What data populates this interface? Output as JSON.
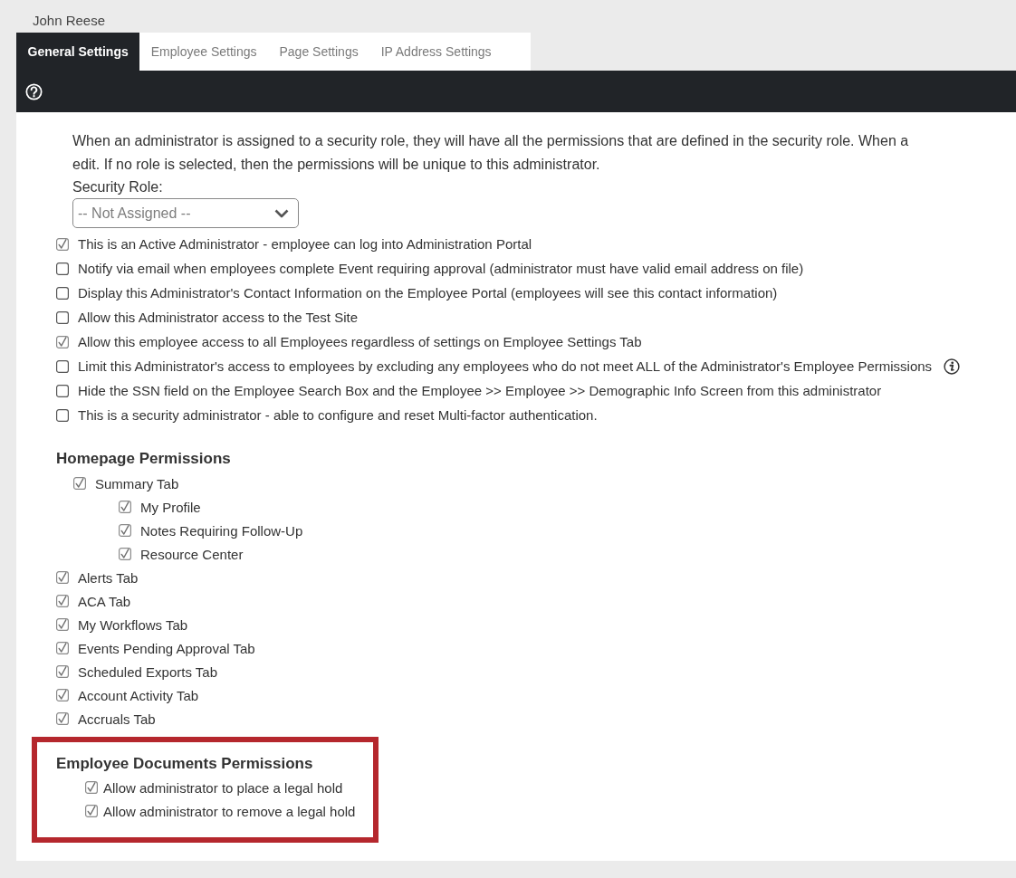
{
  "user": {
    "name": "John Reese"
  },
  "tabs": [
    {
      "label": "General Settings",
      "selected": true
    },
    {
      "label": "Employee Settings",
      "selected": false
    },
    {
      "label": "Page Settings",
      "selected": false
    },
    {
      "label": "IP Address Settings",
      "selected": false
    }
  ],
  "intro": {
    "text": "When an administrator is assigned to a security role, they will have all the permissions that are defined in the security role. When a\nedit. If no role is selected, then the permissions will be unique to this administrator.",
    "security_role": {
      "label": "Security Role:",
      "value": "-- Not Assigned --"
    }
  },
  "options": [
    {
      "label": "This is an Active Administrator - employee can log into Administration Portal",
      "checked": true,
      "info": false
    },
    {
      "label": "Notify via email when employees complete Event requiring approval (administrator must have valid email address on file)",
      "checked": false,
      "info": false
    },
    {
      "label": "Display this Administrator's Contact Information on the Employee Portal (employees will see this contact information)",
      "checked": false,
      "info": false
    },
    {
      "label": "Allow this Administrator access to the Test Site",
      "checked": false,
      "info": false
    },
    {
      "label": "Allow this employee access to all Employees regardless of settings on Employee Settings Tab",
      "checked": true,
      "info": false
    },
    {
      "label": "Limit this Administrator's access to employees by excluding any employees who do not meet ALL of the Administrator's Employee Permissions",
      "checked": false,
      "info": true
    },
    {
      "label": "Hide the SSN field on the Employee Search Box and the Employee >> Employee >> Demographic Info Screen from this administrator",
      "checked": false,
      "info": false
    },
    {
      "label": "This is a security administrator - able to configure and reset Multi-factor authentication.",
      "checked": false,
      "info": false
    }
  ],
  "sections": [
    {
      "title": "Homepage Permissions",
      "highlighted": false,
      "items": [
        {
          "label": "Summary Tab",
          "checked": true,
          "children": [
            {
              "label": "My Profile",
              "checked": true
            },
            {
              "label": "Notes Requiring Follow-Up",
              "checked": true
            },
            {
              "label": "Resource Center",
              "checked": true
            }
          ]
        },
        {
          "label": "Alerts Tab",
          "checked": true
        },
        {
          "label": "ACA Tab",
          "checked": true
        },
        {
          "label": "My Workflows Tab",
          "checked": true
        },
        {
          "label": "Events Pending Approval Tab",
          "checked": true
        },
        {
          "label": "Scheduled Exports Tab",
          "checked": true
        },
        {
          "label": "Account Activity Tab",
          "checked": true
        },
        {
          "label": "Accruals Tab",
          "checked": true
        }
      ]
    },
    {
      "title": "Employee Documents Permissions",
      "highlighted": true,
      "items": [
        {
          "label": "Allow administrator to place a legal hold",
          "checked": true
        },
        {
          "label": "Allow administrator to remove a legal hold",
          "checked": true
        }
      ]
    }
  ]
}
